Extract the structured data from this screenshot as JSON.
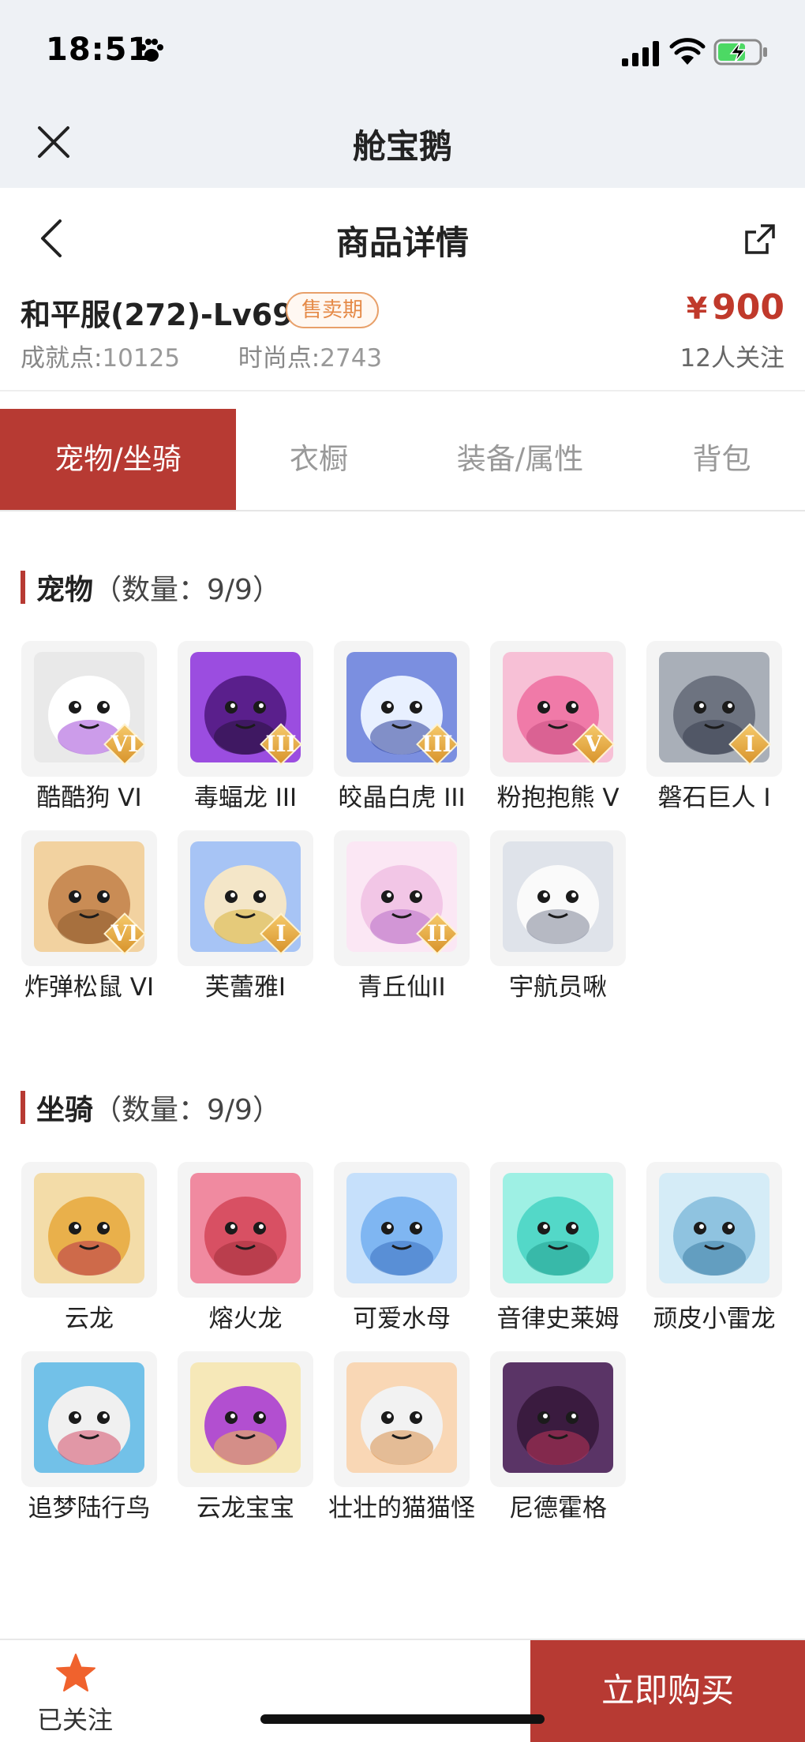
{
  "status_bar": {
    "time": "18:51"
  },
  "mini_program": {
    "title": "舱宝鹅"
  },
  "nav": {
    "title": "商品详情"
  },
  "product": {
    "name": "和平服(272)-Lv69",
    "status_badge": "售卖期",
    "achievement_label": "成就点:",
    "achievement_value": "10125",
    "fashion_label": "时尚点:",
    "fashion_value": "2743",
    "currency": "¥",
    "price": "900",
    "followers": "12人关注"
  },
  "tabs": [
    {
      "label": "宠物/坐骑",
      "active": true
    },
    {
      "label": "衣橱",
      "active": false
    },
    {
      "label": "装备/属性",
      "active": false
    },
    {
      "label": "背包",
      "active": false
    }
  ],
  "pets": {
    "title": "宠物",
    "count_text": "（数量：9/9）",
    "items": [
      {
        "name": "酷酷狗 VI",
        "tier": "VI",
        "icon": "white-bear-goggles-icon"
      },
      {
        "name": "毒蝠龙 III",
        "tier": "III",
        "icon": "purple-bat-dragon-icon"
      },
      {
        "name": "皎晶白虎 III",
        "tier": "III",
        "icon": "white-tiger-icon"
      },
      {
        "name": "粉抱抱熊 V",
        "tier": "V",
        "icon": "pink-bear-icon"
      },
      {
        "name": "磐石巨人 I",
        "tier": "I",
        "icon": "stone-giant-icon"
      },
      {
        "name": "炸弹松鼠 VI",
        "tier": "VI",
        "icon": "bomb-squirrel-icon"
      },
      {
        "name": "芙蕾雅I",
        "tier": "I",
        "icon": "freya-icon"
      },
      {
        "name": "青丘仙II",
        "tier": "II",
        "icon": "fox-fairy-icon"
      },
      {
        "name": "宇航员啾",
        "tier": "",
        "icon": "astronaut-cow-icon"
      }
    ]
  },
  "mounts": {
    "title": "坐骑",
    "count_text": "（数量：9/9）",
    "items": [
      {
        "name": "云龙",
        "icon": "cloud-dragon-icon"
      },
      {
        "name": "熔火龙",
        "icon": "lava-dragon-icon"
      },
      {
        "name": "可爱水母",
        "icon": "jellyfish-icon"
      },
      {
        "name": "音律史莱姆",
        "icon": "slime-icon"
      },
      {
        "name": "顽皮小雷龙",
        "icon": "little-dino-icon"
      },
      {
        "name": "追梦陆行鸟",
        "icon": "dream-bird-icon"
      },
      {
        "name": "云龙宝宝",
        "icon": "baby-cloud-dragon-icon"
      },
      {
        "name": "壮壮的猫猫怪",
        "icon": "chubby-cat-icon"
      },
      {
        "name": "尼德霍格",
        "icon": "nidhogg-dragon-icon"
      }
    ]
  },
  "bottom_bar": {
    "follow_label": "已关注",
    "buy_label": "立即购买"
  },
  "colors": {
    "accent": "#b73a33",
    "badge": "#e58a48",
    "star": "#f0622d",
    "tier_gold": "#d8942c"
  }
}
